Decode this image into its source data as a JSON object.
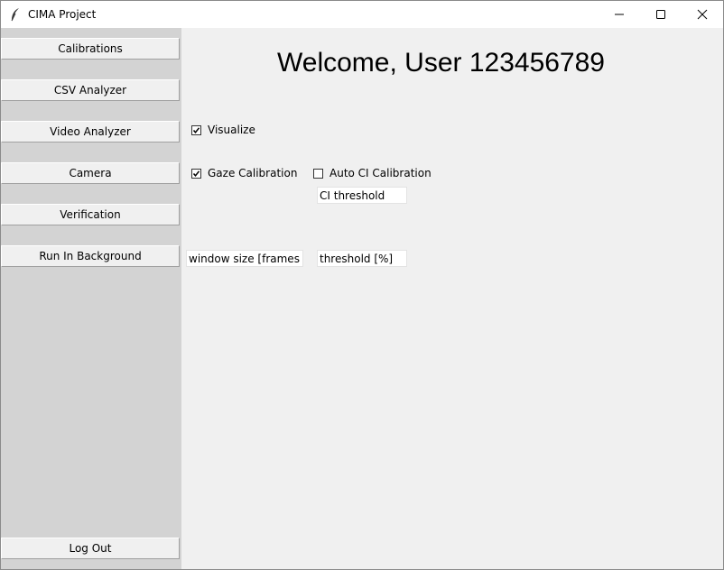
{
  "window": {
    "title": "CIMA Project"
  },
  "sidebar": {
    "items": [
      {
        "label": "Calibrations"
      },
      {
        "label": "CSV Analyzer"
      },
      {
        "label": "Video Analyzer"
      },
      {
        "label": "Camera"
      },
      {
        "label": "Verification"
      },
      {
        "label": "Run In Background"
      }
    ],
    "logout_label": "Log Out"
  },
  "main": {
    "welcome": "Welcome, User 123456789",
    "visualize": {
      "label": "Visualize",
      "checked": true
    },
    "gaze_calibration": {
      "label": "Gaze Calibration",
      "checked": true
    },
    "auto_ci_calibration": {
      "label": "Auto CI Calibration",
      "checked": false
    },
    "ci_threshold": {
      "value": "CI threshold"
    },
    "window_size": {
      "value": "window size [frames]"
    },
    "threshold": {
      "value": "threshold [%]"
    }
  },
  "colors": {
    "sidebar_bg": "#d3d3d3",
    "main_bg": "#f0f0f0",
    "titlebar_bg": "#ffffff"
  }
}
